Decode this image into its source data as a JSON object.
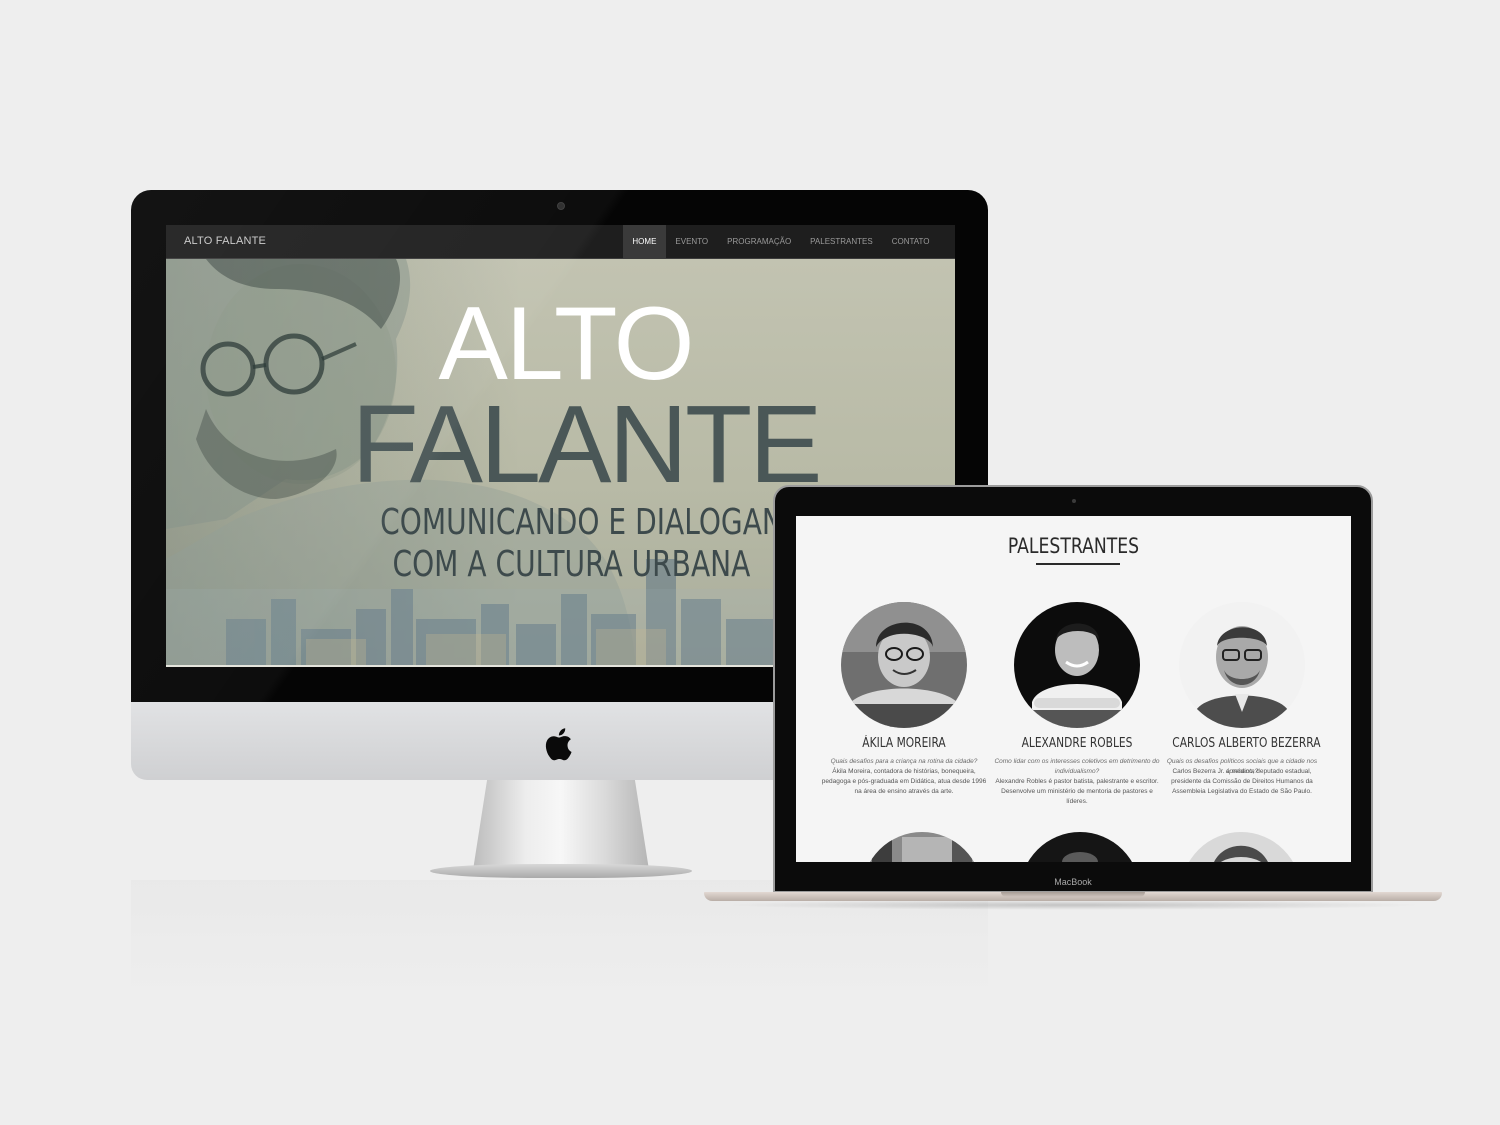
{
  "imac": {
    "site": {
      "brand": "ALTO FALANTE",
      "nav": [
        {
          "label": "HOME",
          "active": true
        },
        {
          "label": "EVENTO",
          "active": false
        },
        {
          "label": "PROGRAMAÇÃO",
          "active": false
        },
        {
          "label": "PALESTRANTES",
          "active": false
        },
        {
          "label": "CONTATO",
          "active": false
        }
      ],
      "hero": {
        "line1": "ALTO",
        "line2": "FALANTE",
        "subtitle_line1": "COMUNICANDO E DIALOGANDO",
        "subtitle_line2": "COM A CULTURA URBANA"
      }
    }
  },
  "macbook": {
    "label": "MacBook",
    "page": {
      "title": "PALESTRANTES",
      "speakers": [
        {
          "name": "ÁKILA MOREIRA",
          "question": "Quais desafios para a criança na rotina da cidade?",
          "bio": "Ákila Moreira, contadora de histórias, bonequeira, pedagoga e pós-graduada em Didática, atua desde 1996 na área de ensino através da arte."
        },
        {
          "name": "ALEXANDRE ROBLES",
          "question": "Como lidar com os interesses coletivos em detrimento do individualismo?",
          "bio": "Alexandre Robles é pastor batista, palestrante e escritor. Desenvolve um ministério de mentoria de pastores e líderes."
        },
        {
          "name": "CARLOS ALBERTO BEZERRA",
          "question": "Quais os desafios políticos sociais que a cidade nos apresenta?",
          "bio": "Carlos Bezerra Jr. é médico, deputado estadual, presidente da Comissão de Direitos Humanos da Assembleia Legislativa do Estado de São Paulo."
        }
      ]
    }
  },
  "colors": {
    "background": "#eeeeee",
    "nav_bg": "#1e1e1e",
    "nav_active_bg": "#3a3a3a",
    "hero_title_white": "#ffffff",
    "hero_title_dark": "#4a5757"
  },
  "icons": {
    "apple": "apple-logo-icon",
    "camera": "camera-dot-icon"
  }
}
